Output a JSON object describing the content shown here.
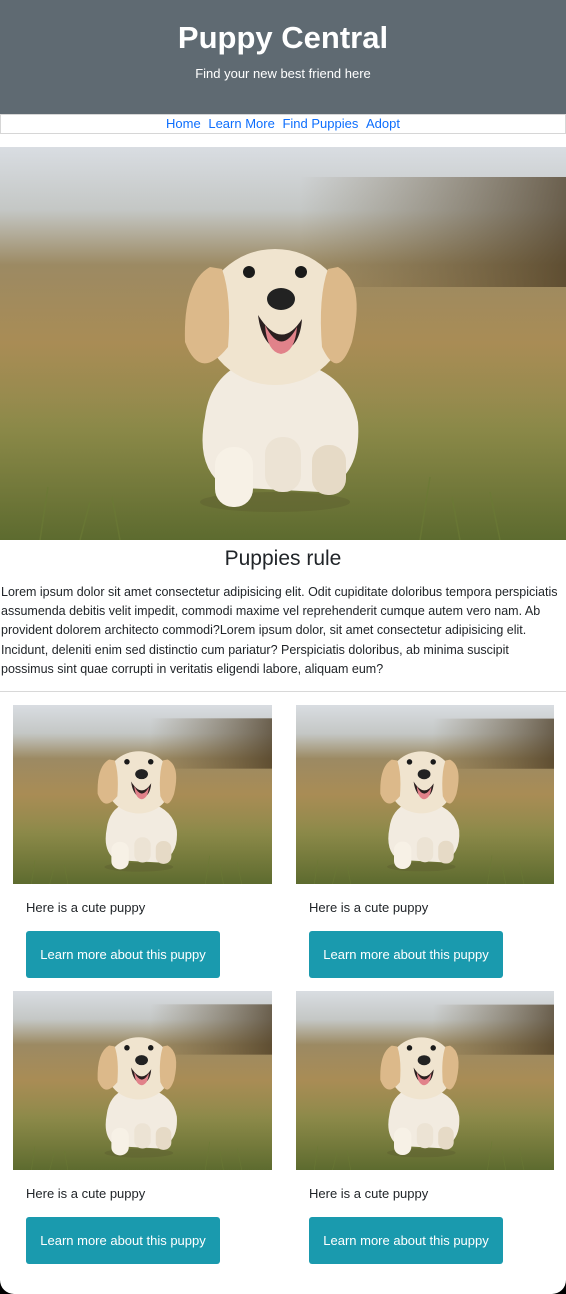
{
  "header": {
    "title": "Puppy Central",
    "subtitle": "Find your new best friend here"
  },
  "nav": {
    "items": [
      {
        "label": "Home"
      },
      {
        "label": "Learn More"
      },
      {
        "label": "Find Puppies"
      },
      {
        "label": "Adopt"
      }
    ]
  },
  "hero": {
    "image": "puppy-photo"
  },
  "section": {
    "title": "Puppies rule",
    "body": "Lorem ipsum dolor sit amet consectetur adipisicing elit. Odit cupiditate doloribus tempora perspiciatis assumenda debitis velit impedit, commodi maxime vel reprehenderit cumque autem vero nam. Ab provident dolorem architecto commodi?Lorem ipsum dolor, sit amet consectetur adipisicing elit. Incidunt, deleniti enim sed distinctio cum pariatur? Perspiciatis doloribus, ab minima suscipit possimus sint quae corrupti in veritatis eligendi labore, aliquam eum?"
  },
  "cards": [
    {
      "text": "Here is a cute puppy",
      "button": "Learn more about this puppy"
    },
    {
      "text": "Here is a cute puppy",
      "button": "Learn more about this puppy"
    },
    {
      "text": "Here is a cute puppy",
      "button": "Learn more about this puppy"
    },
    {
      "text": "Here is a cute puppy",
      "button": "Learn more about this puppy"
    }
  ],
  "colors": {
    "header_bg": "#5f6a72",
    "link": "#0d6efd",
    "button_bg": "#1a9aae"
  }
}
